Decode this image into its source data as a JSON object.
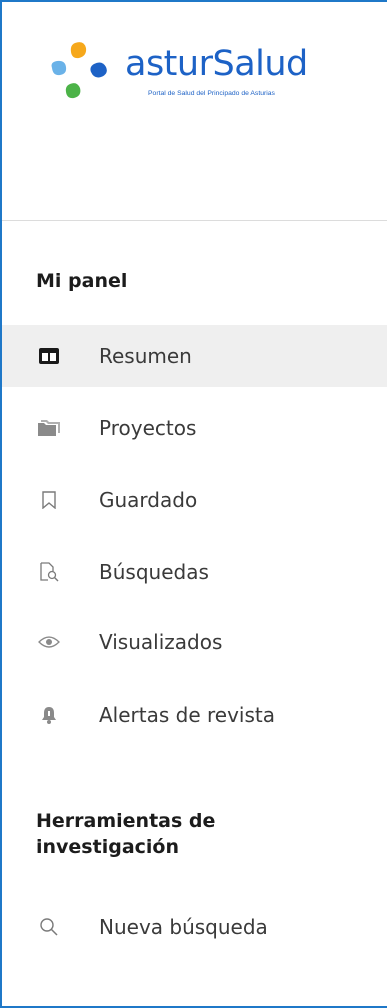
{
  "logo": {
    "word_part1": "astur",
    "word_part2": "Salud",
    "tagline": "Portal de Salud del Principado de Asturias",
    "colors": {
      "orange": "#f6a81b",
      "blue": "#1d62c6",
      "green": "#4cb348",
      "light_blue": "#6ab2e8"
    }
  },
  "sections": {
    "mi_panel": "Mi panel",
    "herramientas": "Herramientas de investigación"
  },
  "nav": {
    "items": [
      {
        "label": "Resumen",
        "icon": "summary-icon",
        "active": true
      },
      {
        "label": "Proyectos",
        "icon": "folder-icon",
        "active": false
      },
      {
        "label": "Guardado",
        "icon": "bookmark-icon",
        "active": false
      },
      {
        "label": "Búsquedas",
        "icon": "search-document-icon",
        "active": false
      },
      {
        "label": "Visualizados",
        "icon": "eye-icon",
        "active": false
      },
      {
        "label": "Alertas de revista",
        "icon": "bell-icon",
        "active": false
      }
    ],
    "tools": [
      {
        "label": "Nueva búsqueda",
        "icon": "search-icon"
      }
    ]
  },
  "colors": {
    "frame_border": "#1f78c8",
    "active_bg": "#efefef"
  }
}
